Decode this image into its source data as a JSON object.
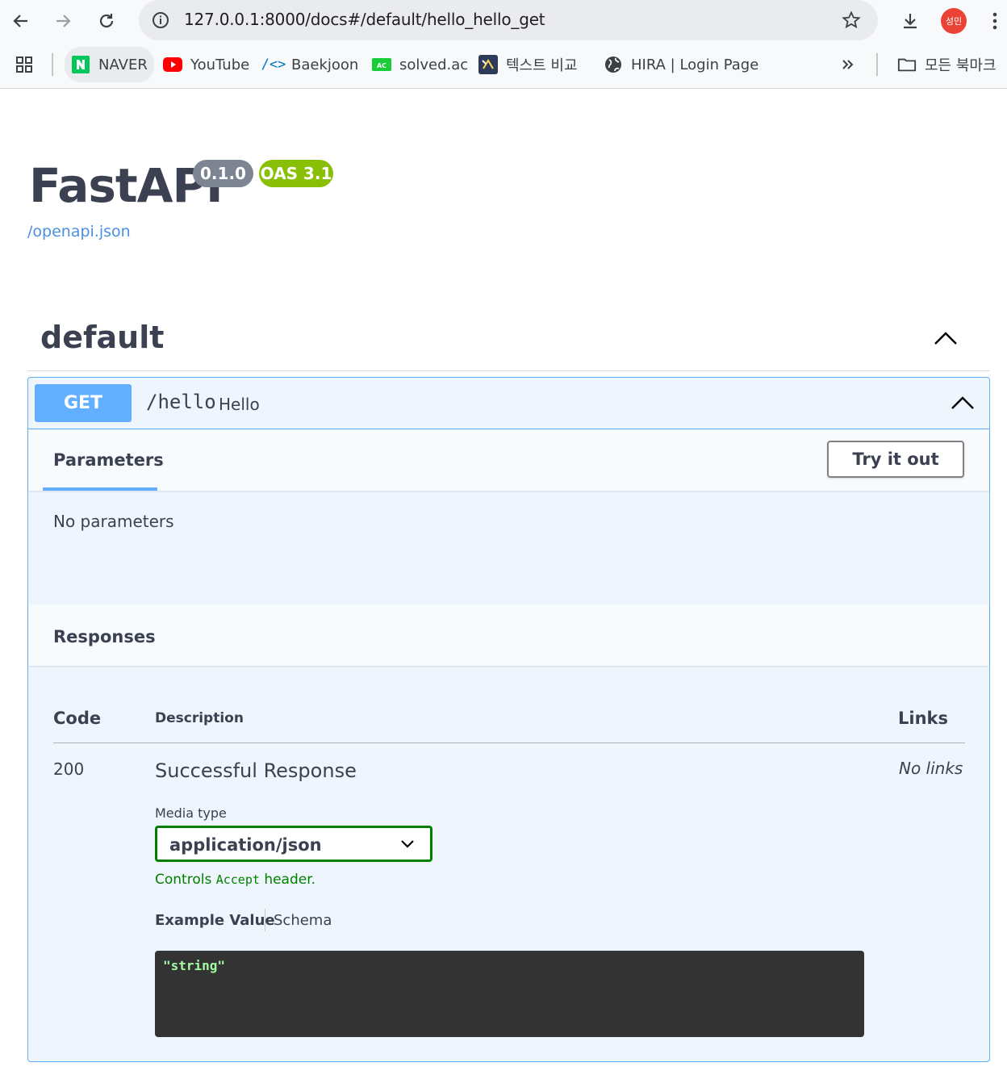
{
  "browser": {
    "url": "127.0.0.1:8000/docs#/default/hello_hello_get",
    "profile_initials": "성민",
    "bookmarks": [
      {
        "label": "NAVER",
        "icon": "naver-icon"
      },
      {
        "label": "YouTube",
        "icon": "youtube-icon"
      },
      {
        "label": "Baekjoon",
        "icon": "code-brackets-icon"
      },
      {
        "label": "solved.ac",
        "icon": "solvedac-icon"
      },
      {
        "label": "텍스트 비교",
        "icon": "text-compare-icon"
      },
      {
        "label": "HIRA | Login Page",
        "icon": "globe-icon"
      }
    ],
    "all_bookmarks_label": "모든 북마크"
  },
  "info": {
    "title": "FastAPI",
    "version": "0.1.0",
    "oas_version": "OAS 3.1",
    "spec_link": "/openapi.json"
  },
  "tag": {
    "name": "default"
  },
  "operation": {
    "method": "GET",
    "path": "/hello",
    "summary": "Hello",
    "parameters_tab": "Parameters",
    "try_it_out": "Try it out",
    "no_parameters": "No parameters",
    "responses_title": "Responses",
    "table_headers": {
      "code": "Code",
      "description": "Description",
      "links": "Links"
    },
    "responses": [
      {
        "code": "200",
        "description": "Successful Response",
        "links": "No links",
        "media_type_label": "Media type",
        "media_type": "application/json",
        "controls_prefix": "Controls",
        "controls_code": "Accept",
        "controls_suffix": "header.",
        "example_tab": "Example Value",
        "schema_tab": "Schema",
        "example": "\"string\""
      }
    ]
  },
  "colors": {
    "get_blue": "#61affe",
    "op_background": "#eef5fc",
    "version_badge": "#7d8492",
    "oas_badge": "#89bf04",
    "select_border": "#008000",
    "code_background": "#333333",
    "code_text": "#a2fca2"
  }
}
